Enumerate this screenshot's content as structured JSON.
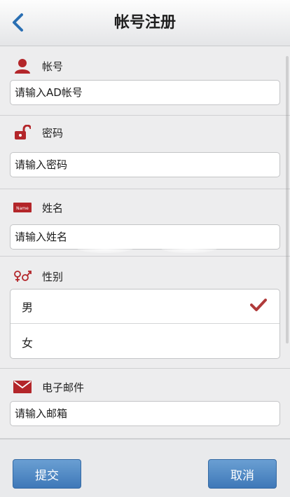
{
  "header": {
    "title": "帐号注册",
    "back_icon": "chevron-left-icon"
  },
  "form": {
    "account": {
      "label": "帐号",
      "icon": "user-icon",
      "placeholder": "请输入AD帐号",
      "value": ""
    },
    "password": {
      "label": "密码",
      "icon": "unlock-icon",
      "placeholder": "请输入密码",
      "value": ""
    },
    "name": {
      "label": "姓名",
      "icon": "name-tag-icon",
      "badge_text": "Name",
      "placeholder": "请输入姓名",
      "value": ""
    },
    "gender": {
      "label": "性别",
      "icon": "gender-icon",
      "options": [
        {
          "label": "男",
          "selected": true
        },
        {
          "label": "女",
          "selected": false
        }
      ]
    },
    "email": {
      "label": "电子邮件",
      "icon": "mail-icon",
      "placeholder": "请输入邮箱",
      "value": ""
    }
  },
  "footer": {
    "submit_label": "提交",
    "cancel_label": "取消"
  },
  "colors": {
    "accent": "#3e78b8",
    "icon_red": "#b3262a",
    "check": "#b03a3a"
  }
}
